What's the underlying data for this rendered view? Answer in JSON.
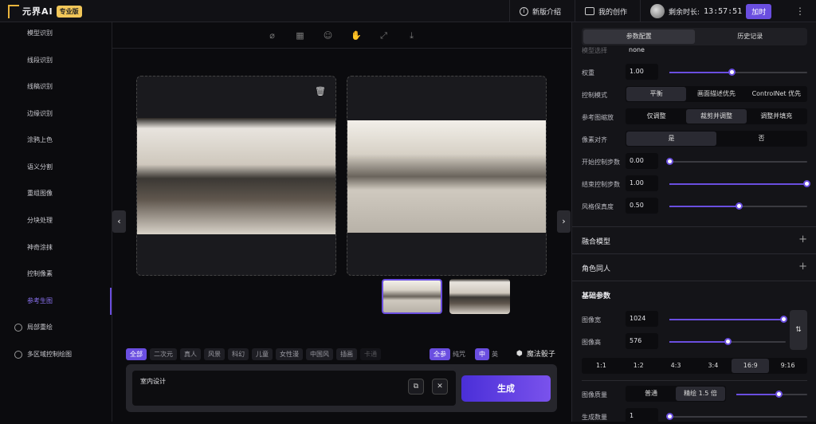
{
  "topbar": {
    "logo_text": "元界AI",
    "pro_badge": "专业版",
    "news": "新版介绍",
    "my_works": "我的创作",
    "remaining_label": "剩余时长:",
    "remaining_time": "13:57:51",
    "add_time": "加时"
  },
  "sidebar": {
    "items": [
      "模型识别",
      "线段识别",
      "线稿识别",
      "边缘识别",
      "涂鸦上色",
      "语义分割",
      "重组图像",
      "分块处理",
      "神奇涂抹",
      "控制像素",
      "参考生图"
    ],
    "active": "参考生图",
    "extra": [
      "局部重绘",
      "多区域控制绘图"
    ]
  },
  "main": {
    "tags": [
      "全部",
      "二次元",
      "真人",
      "风景",
      "科幻",
      "儿童",
      "女性漫",
      "中国风",
      "插画",
      "卡通"
    ],
    "toggle1_on": "全参",
    "toggle1_off": "纯咒",
    "toggle2_on": "中",
    "toggle2_off": "英",
    "dice": "魔法骰子",
    "prompt": "室内设计",
    "generate": "生成"
  },
  "right": {
    "tab_params": "参数配置",
    "tab_history": "历史记录",
    "model_label": "模型选择",
    "model_value": "none",
    "weight_label": "权重",
    "weight_value": "1.00",
    "weight_level": 0.45,
    "control_mode_label": "控制模式",
    "control_modes": [
      "平衡",
      "画面描述优先",
      "ControlNet 优先"
    ],
    "ref_scale_label": "参考图缩放",
    "ref_scales": [
      "仅调整",
      "裁剪并调整",
      "调整并填充"
    ],
    "pixel_align_label": "像素对齐",
    "pixel_align": [
      "是",
      "否"
    ],
    "start_label": "开始控制步数",
    "start_value": "0.00",
    "start_level": 0.0,
    "end_label": "结束控制步数",
    "end_value": "1.00",
    "end_level": 1.0,
    "style_label": "风格保真度",
    "style_value": "0.50",
    "style_level": 0.5,
    "fusion_model": "融合模型",
    "character": "角色同人",
    "basic_params": "基础参数",
    "width_label": "图像宽",
    "width_value": "1024",
    "width_level": 0.98,
    "height_label": "图像高",
    "height_value": "576",
    "height_level": 0.5,
    "ratios": [
      "1:1",
      "1:2",
      "4:3",
      "3:4",
      "16:9",
      "9:16"
    ],
    "quality_label": "图像质量",
    "quality_options": [
      "普通",
      "精绘 1.5 倍"
    ],
    "quality_level": 0.6,
    "count_label": "生成数量",
    "count_value": "1",
    "count_level": 0.0
  }
}
